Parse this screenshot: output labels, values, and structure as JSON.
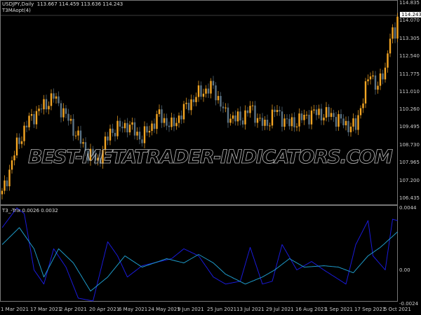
{
  "header": {
    "symbol_line": "USDJPY,Daily  113.667 114.459 113.636 114.243",
    "indicator_name": "T3MAopt(4)"
  },
  "subwindow": {
    "label": "T3_-Trix 0.0026 0.0032"
  },
  "watermark": "BEST-METATRADER-INDICATORS.COM",
  "colors": {
    "bull": "#f5a623",
    "bear": "#5b7385",
    "trix_fast": "#1a1ad8",
    "trix_slow": "#1e9ac8",
    "grid": "#777777"
  },
  "chart_data": [
    {
      "type": "candlestick",
      "title": "USDJPY,Daily",
      "current_price": "114.243",
      "y_ticks": [
        "114.835",
        "114.070",
        "113.305",
        "112.540",
        "111.775",
        "111.010",
        "110.260",
        "109.495",
        "108.730",
        "107.965",
        "107.200",
        "106.435"
      ],
      "ylim": [
        106.435,
        114.835
      ],
      "x_ticks": [
        {
          "bar": 0,
          "label": "1 Mar 2021"
        },
        {
          "bar": 12,
          "label": "17 Mar 2021"
        },
        {
          "bar": 24,
          "label": "2 Apr 2021"
        },
        {
          "bar": 36,
          "label": "20 Apr 2021"
        },
        {
          "bar": 48,
          "label": "6 May 2021"
        },
        {
          "bar": 60,
          "label": "24 May 2021"
        },
        {
          "bar": 72,
          "label": "9 Jun 2021"
        },
        {
          "bar": 84,
          "label": "25 Jun 2021"
        },
        {
          "bar": 96,
          "label": "13 Jul 2021"
        },
        {
          "bar": 108,
          "label": "29 Jul 2021"
        },
        {
          "bar": 120,
          "label": "16 Aug 2021"
        },
        {
          "bar": 132,
          "label": "1 Sep 2021"
        },
        {
          "bar": 144,
          "label": "17 Sep 2021"
        },
        {
          "bar": 156,
          "label": "5 Oct 2021"
        }
      ],
      "close_path": [
        [
          0,
          106.6
        ],
        [
          6,
          108.7
        ],
        [
          11,
          109.8
        ],
        [
          21,
          110.8
        ],
        [
          27,
          109.8
        ],
        [
          34,
          108.5
        ],
        [
          39,
          108.0
        ],
        [
          44,
          109.3
        ],
        [
          51,
          109.6
        ],
        [
          57,
          109.0
        ],
        [
          64,
          110.0
        ],
        [
          69,
          109.5
        ],
        [
          76,
          110.5
        ],
        [
          81,
          111.0
        ],
        [
          86,
          111.2
        ],
        [
          91,
          110.0
        ],
        [
          97,
          109.8
        ],
        [
          101,
          110.3
        ],
        [
          107,
          109.5
        ],
        [
          111,
          110.2
        ],
        [
          117,
          109.6
        ],
        [
          121,
          109.8
        ],
        [
          127,
          110.1
        ],
        [
          134,
          110.0
        ],
        [
          140,
          109.6
        ],
        [
          144,
          109.5
        ],
        [
          147,
          110.8
        ],
        [
          150,
          111.8
        ],
        [
          153,
          111.2
        ],
        [
          156,
          112.0
        ],
        [
          158,
          113.5
        ],
        [
          160,
          113.3
        ],
        [
          161,
          114.24
        ]
      ]
    },
    {
      "type": "line",
      "title": "T3_-Trix",
      "y_ticks": [
        "0.0044",
        "0.00",
        "-0.0024"
      ],
      "ylim": [
        -0.0024,
        0.0044
      ],
      "series": [
        {
          "values": [
            [
              0,
              0.003
            ],
            [
              6,
              0.0044
            ],
            [
              9,
              0.004
            ],
            [
              13,
              0.0
            ],
            [
              17,
              -0.001
            ],
            [
              21,
              0.0015
            ],
            [
              26,
              0.0002
            ],
            [
              31,
              -0.002
            ],
            [
              37,
              -0.0022
            ],
            [
              43,
              0.002
            ],
            [
              47,
              0.001
            ],
            [
              51,
              -0.0005
            ],
            [
              57,
              0.0003
            ],
            [
              69,
              0.0008
            ],
            [
              74,
              0.0015
            ],
            [
              80,
              0.001
            ],
            [
              86,
              -0.0005
            ],
            [
              91,
              -0.001
            ],
            [
              97,
              -0.0008
            ],
            [
              101,
              0.0016
            ],
            [
              106,
              -0.001
            ],
            [
              110,
              -0.0008
            ],
            [
              114,
              0.0018
            ],
            [
              120,
              0.0
            ],
            [
              126,
              0.0006
            ],
            [
              131,
              0.0
            ],
            [
              140,
              -0.001
            ],
            [
              144,
              0.0018
            ],
            [
              149,
              0.0035
            ],
            [
              151,
              0.001
            ],
            [
              156,
              0.0
            ],
            [
              159,
              0.0036
            ],
            [
              161,
              0.0035
            ]
          ]
        },
        {
          "values": [
            [
              0,
              0.0018
            ],
            [
              7,
              0.003
            ],
            [
              13,
              0.0015
            ],
            [
              17,
              -0.0005
            ],
            [
              23,
              0.0015
            ],
            [
              29,
              0.0005
            ],
            [
              36,
              -0.0015
            ],
            [
              43,
              -0.0005
            ],
            [
              50,
              0.001
            ],
            [
              57,
              0.0002
            ],
            [
              67,
              0.0008
            ],
            [
              74,
              0.0005
            ],
            [
              80,
              0.0011
            ],
            [
              86,
              0.0005
            ],
            [
              91,
              -0.0003
            ],
            [
              99,
              -0.001
            ],
            [
              106,
              -0.0005
            ],
            [
              111,
              0.0
            ],
            [
              117,
              0.0008
            ],
            [
              123,
              0.0002
            ],
            [
              131,
              0.0003
            ],
            [
              137,
              0.0002
            ],
            [
              143,
              -0.0002
            ],
            [
              149,
              0.001
            ],
            [
              154,
              0.0016
            ],
            [
              161,
              0.0027
            ]
          ]
        }
      ]
    }
  ]
}
